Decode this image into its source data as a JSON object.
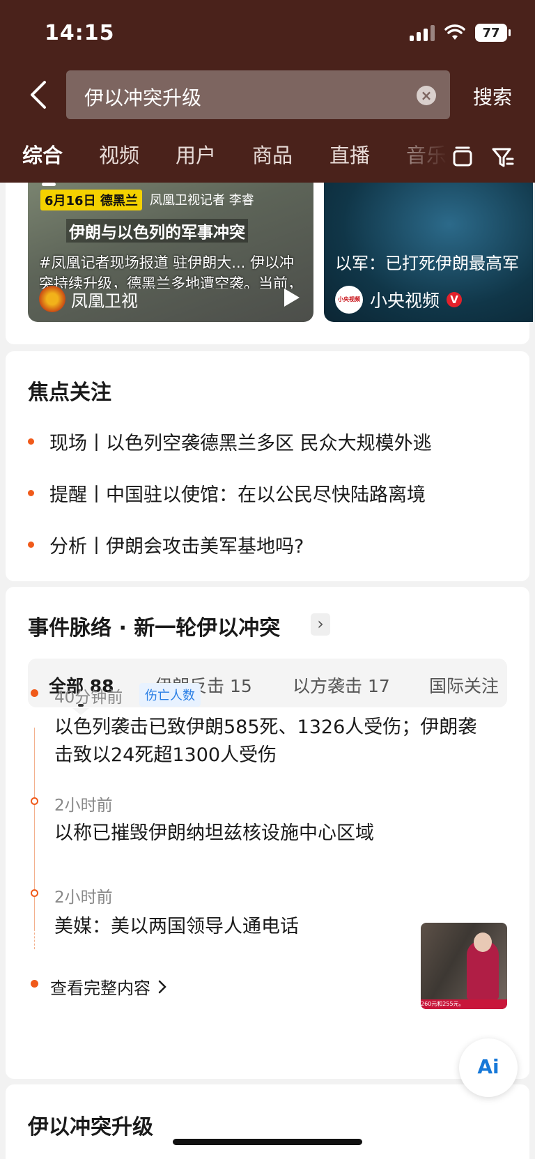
{
  "status": {
    "time": "14:15",
    "battery": "77"
  },
  "search": {
    "query": "伊以冲突升级",
    "button": "搜索"
  },
  "tabs": [
    "综合",
    "视频",
    "用户",
    "商品",
    "直播",
    "音乐"
  ],
  "videos": [
    {
      "date_tag": "6月16日 德黑兰",
      "reporter": "凤凰卫视记者 李睿",
      "headline": "伊朗与以色列的军事冲突",
      "desc": "#凤凰记者现场报道 驻伊朗大... 伊以冲突持续升级，德黑兰多地遭空袭。当前，超过百名中国留学生和华侨… 燃油配给、网络中断和交通瘫痪，撤离困难重重。",
      "source": "凤凰卫视"
    },
    {
      "headline": "以军：已打死伊朗最高军",
      "source": "小央视频",
      "source_logo": "小央视频",
      "verified": "V"
    }
  ],
  "focus": {
    "title": "焦点关注",
    "items": [
      "现场丨以色列空袭德黑兰多区 民众大规模外逃",
      "提醒丨中国驻以使馆：在以公民尽快陆路离境",
      "分析丨伊朗会攻击美军基地吗?"
    ]
  },
  "timeline": {
    "title": "事件脉络 · 新一轮伊以冲突",
    "filters": [
      "全部 88",
      "伊朗反击 15",
      "以方袭击 17",
      "国际关注"
    ],
    "events": [
      {
        "time": "40分钟前",
        "badge": "伤亡人数",
        "text": "以色列袭击已致伊朗585死、1326人受伤；伊朗袭击致以24死超1300人受伤"
      },
      {
        "time": "2小时前",
        "text": "以称已摧毁伊朗纳坦兹核设施中心区域"
      },
      {
        "time": "2小时前",
        "text": "美媒：美以两国领导人通电话",
        "thumb_ticker": "260元和255元。"
      }
    ],
    "more": "查看完整内容"
  },
  "bottom": {
    "title": "伊以冲突升级"
  },
  "ai_button": "Ai",
  "colors": {
    "header_bg": "#4a221b",
    "accent": "#f05a1a",
    "badge_blue": "#2a7fe5"
  }
}
